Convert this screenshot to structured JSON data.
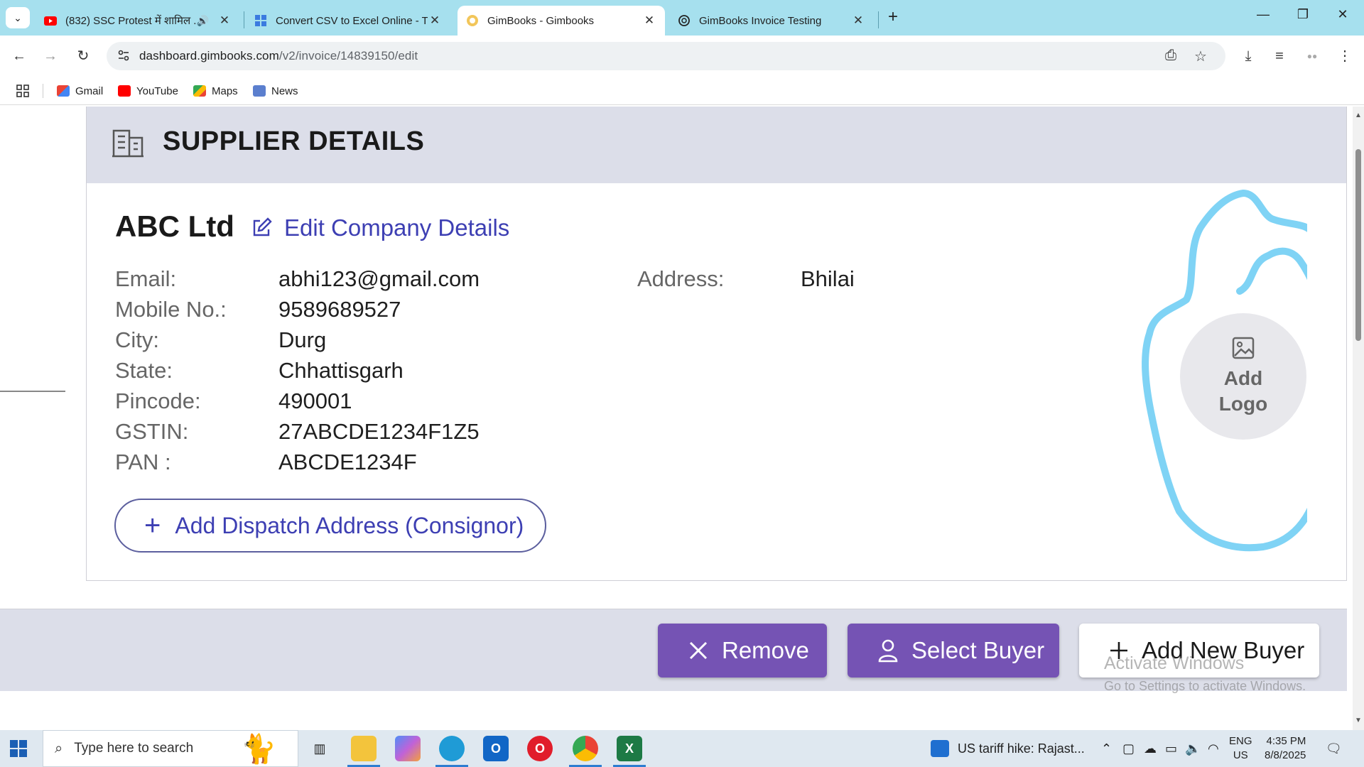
{
  "browser": {
    "tabs": [
      {
        "title": "(832) SSC Protest में शामिल ..."
      },
      {
        "title": "Convert CSV to Excel Online - T"
      },
      {
        "title": "GimBooks - Gimbooks"
      },
      {
        "title": "GimBooks Invoice Testing"
      }
    ],
    "url_host": "dashboard.gimbooks.com",
    "url_path": "/v2/invoice/14839150/edit",
    "bookmarks": [
      "Gmail",
      "YouTube",
      "Maps",
      "News"
    ]
  },
  "supplier": {
    "section_title": "SUPPLIER DETAILS",
    "company_name": "ABC Ltd",
    "edit_link": "Edit Company Details",
    "fields": [
      {
        "label": "Email:",
        "value": "abhi123@gmail.com"
      },
      {
        "label": "Mobile No.:",
        "value": "9589689527"
      },
      {
        "label": "City:",
        "value": "Durg"
      },
      {
        "label": "State:",
        "value": "Chhattisgarh"
      },
      {
        "label": "Pincode:",
        "value": "490001"
      },
      {
        "label": "GSTIN:",
        "value": "27ABCDE1234F1Z5"
      },
      {
        "label": "PAN :",
        "value": "ABCDE1234F"
      }
    ],
    "address_label": "Address:",
    "address_value": "Bhilai",
    "dispatch_button": "Add Dispatch Address (Consignor)",
    "logo_line1": "Add",
    "logo_line2": "Logo"
  },
  "buyer": {
    "remove_button": "Remove",
    "select_button": "Select Buyer",
    "add_button": "Add New Buyer"
  },
  "watermark": {
    "line1": "Activate Windows",
    "line2": "Go to Settings to activate Windows."
  },
  "taskbar": {
    "search_placeholder": "Type here to search",
    "news_text": "US tariff hike: Rajast...",
    "lang_line1": "ENG",
    "lang_line2": "US",
    "time": "4:35 PM",
    "date": "8/8/2025"
  },
  "colors": {
    "accent_purple": "#7553b4",
    "link_blue": "#3d3fb3",
    "header_band": "#dcdee9",
    "annotation": "#7fd3f5"
  }
}
